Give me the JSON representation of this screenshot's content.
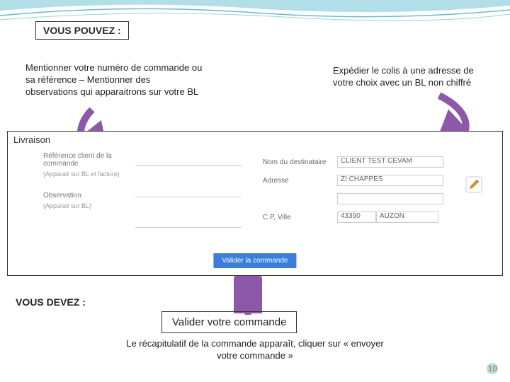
{
  "titles": {
    "pouvez": "VOUS POUVEZ :",
    "devez": "VOUS DEVEZ :"
  },
  "callouts": {
    "left": "Mentionner votre numéro de commande ou sa référence – Mentionner des observations qui apparaitrons sur votre BL",
    "right": "Expédier le colis à une adresse de votre choix avec un BL non chiffré",
    "validate": "Valider votre commande",
    "bottom": "Le récapitulatif de la commande apparaît, cliquer sur « envoyer votre commande »"
  },
  "form": {
    "section_title": "Livraison",
    "ref_label": "Référence client de la commande",
    "ref_sub": "(Apparait sur BL et facture)",
    "obs_label": "Observation",
    "obs_sub": "(Apparait sur BL)",
    "dest_label": "Nom du destinataire",
    "dest_value": "CLIENT TEST CEVAM",
    "addr_label": "Adresse",
    "addr_value": "ZI CHAPPES",
    "cp_label": "C.P, Ville",
    "cp_value": "43390",
    "ville_value": "AUZON",
    "button": "Valider la commande"
  },
  "page_number": "10"
}
